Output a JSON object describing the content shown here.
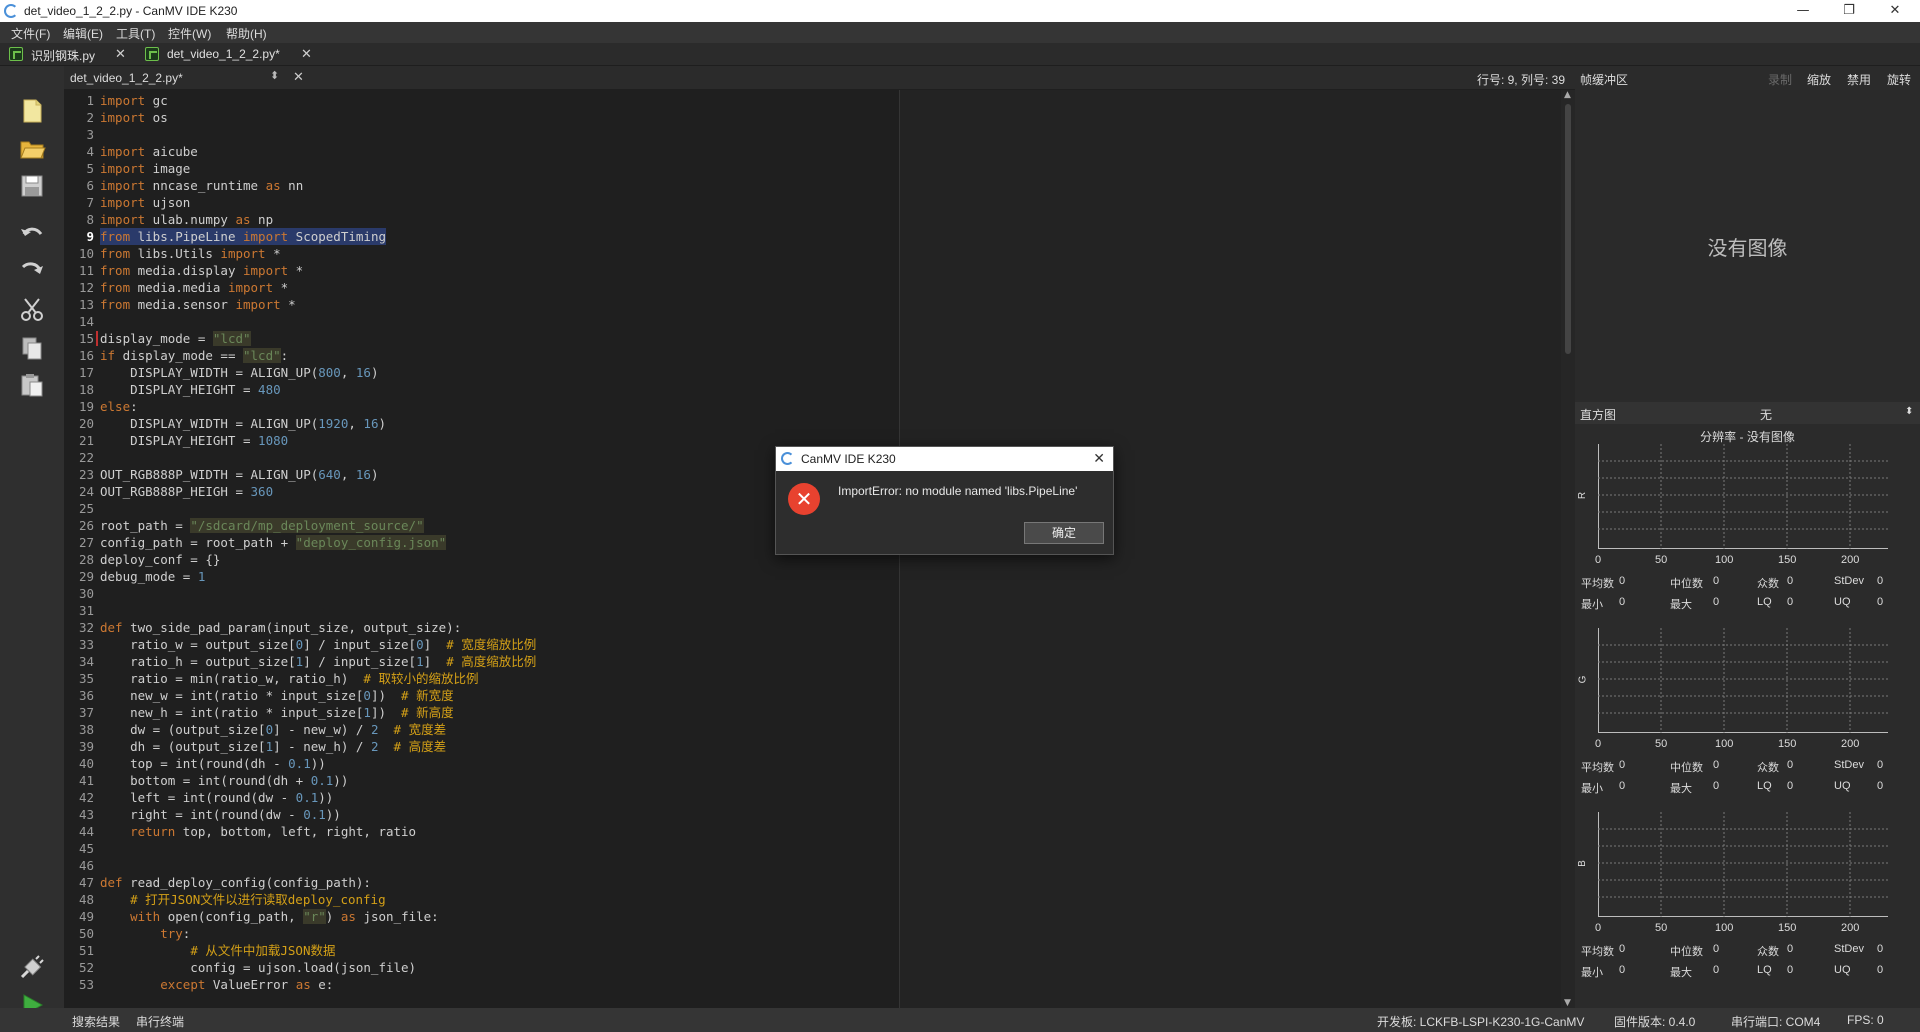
{
  "window": {
    "title": "det_video_1_2_2.py - CanMV IDE K230",
    "minimize": "—",
    "maximize": "❐",
    "close": "✕"
  },
  "menu": [
    "文件(F)",
    "编辑(E)",
    "工具(T)",
    "控件(W)",
    "帮助(H)"
  ],
  "tabs": [
    {
      "label": "识别钢珠.py",
      "close": "✕"
    },
    {
      "label": "det_video_1_2_2.py*",
      "close": "✕"
    }
  ],
  "editor_header": {
    "doc": "det_video_1_2_2.py*",
    "arrows": "⬍",
    "close": "✕",
    "position": "行号: 9, 列号: 39"
  },
  "code": [
    {
      "n": "1",
      "t": "import gc"
    },
    {
      "n": "2",
      "t": "import os"
    },
    {
      "n": "3",
      "t": ""
    },
    {
      "n": "4",
      "t": "import aicube"
    },
    {
      "n": "5",
      "t": "import image"
    },
    {
      "n": "6",
      "t": "import nncase_runtime as nn"
    },
    {
      "n": "7",
      "t": "import ujson"
    },
    {
      "n": "8",
      "t": "import ulab.numpy as np"
    },
    {
      "n": "9",
      "t": "from libs.PipeLine import ScopedTiming",
      "current": true
    },
    {
      "n": "10",
      "t": "from libs.Utils import *"
    },
    {
      "n": "11",
      "t": "from media.display import *"
    },
    {
      "n": "12",
      "t": "from media.media import *"
    },
    {
      "n": "13",
      "t": "from media.sensor import *"
    },
    {
      "n": "14",
      "t": ""
    },
    {
      "n": "15",
      "t": "display_mode = \"lcd\"",
      "marker": true
    },
    {
      "n": "16",
      "t": "if display_mode == \"lcd\":"
    },
    {
      "n": "17",
      "t": "    DISPLAY_WIDTH = ALIGN_UP(800, 16)"
    },
    {
      "n": "18",
      "t": "    DISPLAY_HEIGHT = 480"
    },
    {
      "n": "19",
      "t": "else:"
    },
    {
      "n": "20",
      "t": "    DISPLAY_WIDTH = ALIGN_UP(1920, 16)"
    },
    {
      "n": "21",
      "t": "    DISPLAY_HEIGHT = 1080"
    },
    {
      "n": "22",
      "t": ""
    },
    {
      "n": "23",
      "t": "OUT_RGB888P_WIDTH = ALIGN_UP(640, 16)"
    },
    {
      "n": "24",
      "t": "OUT_RGB888P_HEIGH = 360"
    },
    {
      "n": "25",
      "t": ""
    },
    {
      "n": "26",
      "t": "root_path = \"/sdcard/mp_deployment_source/\""
    },
    {
      "n": "27",
      "t": "config_path = root_path + \"deploy_config.json\""
    },
    {
      "n": "28",
      "t": "deploy_conf = {}"
    },
    {
      "n": "29",
      "t": "debug_mode = 1"
    },
    {
      "n": "30",
      "t": ""
    },
    {
      "n": "31",
      "t": ""
    },
    {
      "n": "32",
      "t": "def two_side_pad_param(input_size, output_size):"
    },
    {
      "n": "33",
      "t": "    ratio_w = output_size[0] / input_size[0]  # 宽度缩放比例"
    },
    {
      "n": "34",
      "t": "    ratio_h = output_size[1] / input_size[1]  # 高度缩放比例"
    },
    {
      "n": "35",
      "t": "    ratio = min(ratio_w, ratio_h)  # 取较小的缩放比例"
    },
    {
      "n": "36",
      "t": "    new_w = int(ratio * input_size[0])  # 新宽度"
    },
    {
      "n": "37",
      "t": "    new_h = int(ratio * input_size[1])  # 新高度"
    },
    {
      "n": "38",
      "t": "    dw = (output_size[0] - new_w) / 2  # 宽度差"
    },
    {
      "n": "39",
      "t": "    dh = (output_size[1] - new_h) / 2  # 高度差"
    },
    {
      "n": "40",
      "t": "    top = int(round(dh - 0.1))"
    },
    {
      "n": "41",
      "t": "    bottom = int(round(dh + 0.1))"
    },
    {
      "n": "42",
      "t": "    left = int(round(dw - 0.1))"
    },
    {
      "n": "43",
      "t": "    right = int(round(dw - 0.1))"
    },
    {
      "n": "44",
      "t": "    return top, bottom, left, right, ratio"
    },
    {
      "n": "45",
      "t": ""
    },
    {
      "n": "46",
      "t": ""
    },
    {
      "n": "47",
      "t": "def read_deploy_config(config_path):"
    },
    {
      "n": "48",
      "t": "    # 打开JSON文件以进行读取deploy_config"
    },
    {
      "n": "49",
      "t": "    with open(config_path, \"r\") as json_file:"
    },
    {
      "n": "50",
      "t": "        try:"
    },
    {
      "n": "51",
      "t": "            # 从文件中加载JSON数据"
    },
    {
      "n": "52",
      "t": "            config = ujson.load(json_file)"
    },
    {
      "n": "53",
      "t": "        except ValueError as e:"
    }
  ],
  "framebuffer": {
    "label": "帧缓冲区",
    "record": "录制",
    "zoom": "缩放",
    "disable": "禁用",
    "rotate": "旋转",
    "no_image": "没有图像"
  },
  "histogram": {
    "label": "直方图",
    "mode": "无",
    "resolution": "分辨率 - 没有图像",
    "channels": [
      "R",
      "G",
      "B"
    ],
    "x_ticks": [
      "0",
      "50",
      "100",
      "150",
      "200"
    ],
    "stats": {
      "mean": "平均数",
      "median": "中位数",
      "mode": "众数",
      "stdev": "StDev",
      "min": "最小",
      "max": "最大",
      "lq": "LQ",
      "uq": "UQ",
      "value": "0"
    }
  },
  "status": {
    "search": "搜索结果",
    "serial": "串行终端",
    "board": "开发板: LCKFB-LSPI-K230-1G-CanMV",
    "firmware": "固件版本: 0.4.0",
    "port": "串行端口: COM4",
    "fps": "FPS: 0"
  },
  "dialog": {
    "title": "CanMV IDE K230",
    "message": "ImportError: no module named 'libs.PipeLine'",
    "ok": "确定",
    "close": "✕",
    "error_glyph": "✕"
  },
  "colors": {
    "accent": "#4a90d9",
    "error": "#e8422f",
    "keyword": "#cc7832",
    "string": "#6a8759"
  }
}
